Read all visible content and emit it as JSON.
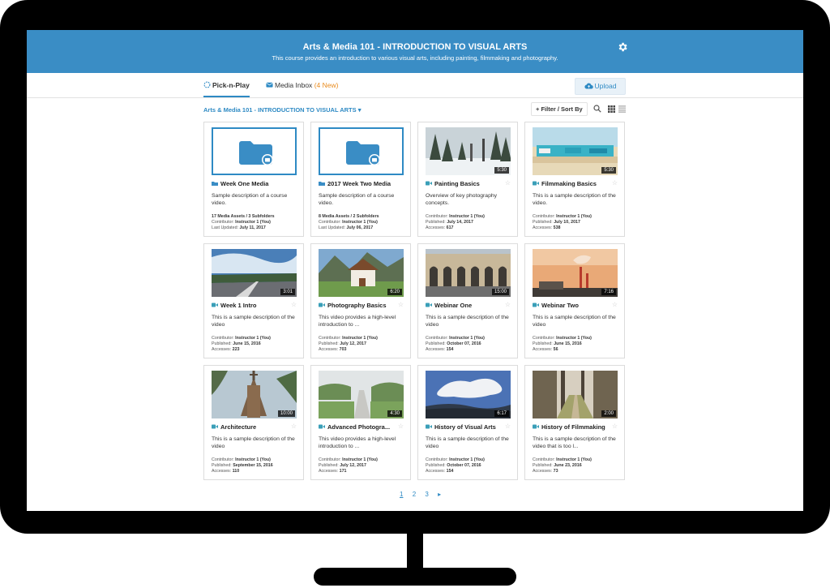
{
  "header": {
    "title": "Arts & Media 101 - INTRODUCTION TO VISUAL ARTS",
    "subtitle": "This course provides an introduction to various visual arts, including painting, filmmaking and photography.",
    "settings_icon": "gear-icon"
  },
  "tabs": [
    {
      "label": "Pick-n-Play",
      "icon": "pick-n-play-icon"
    },
    {
      "label": "Media Inbox",
      "badge": "(4 New)",
      "icon": "inbox-icon"
    }
  ],
  "upload_label": "Upload",
  "breadcrumb": "Arts & Media 101 - INTRODUCTION TO VISUAL ARTS ▾",
  "filter_label": "+ Filter / Sort By",
  "labels": {
    "contributor": "Contributor:",
    "published": "Published:",
    "accesses": "Accesses:",
    "last_updated": "Last Updated:"
  },
  "items": [
    {
      "type": "folder",
      "title": "Week One Media",
      "desc": "Sample description of a course video.",
      "line1": "17 Media Assets / 3 Subfolders",
      "contributor": "Instructor 1 (You)",
      "updated": "July 11, 2017"
    },
    {
      "type": "folder",
      "title": "2017 Week Two Media",
      "desc": "Sample description of a course video.",
      "line1": "8 Media Assets / 2 Subfolders",
      "contributor": "Instructor 1 (You)",
      "updated": "July 06, 2017"
    },
    {
      "type": "video",
      "title": "Painting Basics",
      "desc": "Overview of key photography concepts.",
      "duration": "5:30",
      "contributor": "Instructor 1 (You)",
      "published": "July 14, 2017",
      "accesses": "617"
    },
    {
      "type": "video",
      "title": "Filmmaking Basics",
      "desc": "This is a sample description of the video.",
      "duration": "5:30",
      "contributor": "Instructor 1 (You)",
      "published": "July 10, 2017",
      "accesses": "538"
    },
    {
      "type": "video",
      "title": "Week 1 Intro",
      "desc": "This is a sample description of the video",
      "duration": "3:01",
      "contributor": "Instructor 1 (You)",
      "published": "June 15, 2016",
      "accesses": "223"
    },
    {
      "type": "video",
      "title": "Photography Basics",
      "desc": "This video provides a high-level introduction to ...",
      "duration": "6:20",
      "contributor": "Instructor 1 (You)",
      "published": "July 12, 2017",
      "accesses": "703"
    },
    {
      "type": "video",
      "title": "Webinar One",
      "desc": "This is a sample description of the video",
      "duration": "15:00",
      "contributor": "Instructor 1 (You)",
      "published": "October 07, 2016",
      "accesses": "154"
    },
    {
      "type": "video",
      "title": "Webinar Two",
      "desc": "This is a sample description of the video",
      "duration": "7:16",
      "contributor": "Instructor 1 (You)",
      "published": "June 15, 2016",
      "accesses": "56"
    },
    {
      "type": "video",
      "title": "Architecture",
      "desc": "This is a sample description of the video",
      "duration": "10:00",
      "contributor": "Instructor 1 (You)",
      "published": "September 15, 2016",
      "accesses": "110"
    },
    {
      "type": "video",
      "title": "Advanced Photogra...",
      "desc": "This video provides a high-level introduction to ...",
      "duration": "4:30",
      "contributor": "Instructor 1 (You)",
      "published": "July 12, 2017",
      "accesses": "171"
    },
    {
      "type": "video",
      "title": "History of Visual Arts",
      "desc": "This is a sample description of the video",
      "duration": "6:17",
      "contributor": "Instructor 1 (You)",
      "published": "October 07, 2016",
      "accesses": "154"
    },
    {
      "type": "video",
      "title": "History of Filmmaking",
      "desc": "This is a sample description of the video that is too l...",
      "duration": "2:00",
      "contributor": "Instructor 1 (You)",
      "published": "June 23, 2016",
      "accesses": "73"
    }
  ],
  "pagination": {
    "pages": [
      "1",
      "2",
      "3"
    ],
    "current": "1",
    "next": "▸"
  },
  "colors": {
    "banner": "#3a8dc5",
    "accent": "#2e8ac4",
    "badge": "#e98b1e"
  }
}
